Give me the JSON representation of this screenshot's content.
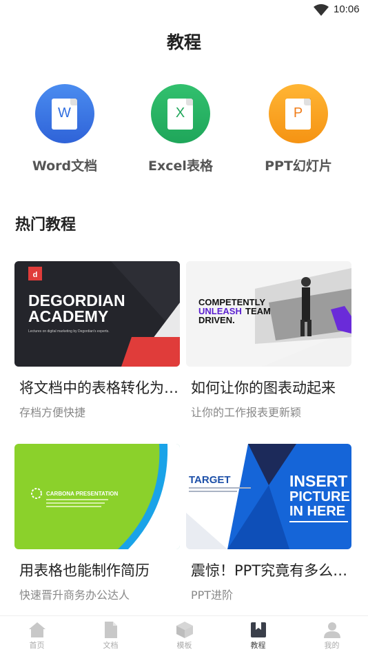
{
  "status_bar": {
    "time": "10:06"
  },
  "header": {
    "title": "教程"
  },
  "categories": [
    {
      "label": "Word文档",
      "letter": "W",
      "icon": "word-icon",
      "color_top": "#4a8cf0",
      "color_bottom": "#2f63d8",
      "letter_color": "#2f6ee0"
    },
    {
      "label": "Excel表格",
      "letter": "X",
      "icon": "excel-icon",
      "color_top": "#32c06e",
      "color_bottom": "#1fa65a",
      "letter_color": "#1fa65a"
    },
    {
      "label": "PPT幻灯片",
      "letter": "P",
      "icon": "ppt-icon",
      "color_top": "#ffb534",
      "color_bottom": "#f59313",
      "letter_color": "#f07d1a"
    }
  ],
  "section": {
    "title": "热门教程"
  },
  "tutorials": [
    {
      "title": "将文档中的表格转化为…",
      "subtitle": "存档方便快捷",
      "thumb_lines": [
        "DEGORDIAN",
        "ACADEMY"
      ],
      "thumb_caption": "Lectures on digital marketing by Degordian's experts."
    },
    {
      "title": "如何让你的图表动起来",
      "subtitle": "让你的工作报表更新颖",
      "thumb_lines": [
        "COMPETENTLY",
        "UNLEASH",
        "TEAM",
        "DRIVEN."
      ]
    },
    {
      "title": "用表格也能制作简历",
      "subtitle": "快速晋升商务办公达人",
      "thumb_lines": [
        "CARBONA PRESENTATION"
      ]
    },
    {
      "title": "震惊！PPT究竟有多么…",
      "subtitle": "PPT进阶",
      "thumb_lines": [
        "TARGET",
        "INSERT",
        "PICTURE",
        "IN HERE"
      ]
    }
  ],
  "tab_bar": {
    "tabs": [
      {
        "label": "首页",
        "icon": "home-icon",
        "active": false
      },
      {
        "label": "文档",
        "icon": "document-icon",
        "active": false
      },
      {
        "label": "模板",
        "icon": "template-icon",
        "active": false
      },
      {
        "label": "教程",
        "icon": "tutorial-icon",
        "active": true
      },
      {
        "label": "我的",
        "icon": "profile-icon",
        "active": false
      }
    ]
  }
}
